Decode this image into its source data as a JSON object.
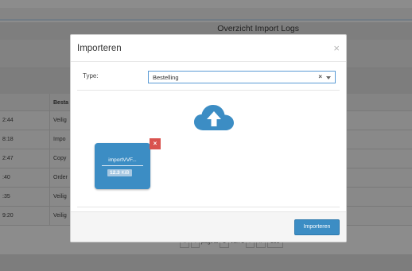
{
  "background": {
    "page_title": "Overzicht Import Logs",
    "table": {
      "header": {
        "col1": "",
        "col2": "Besta"
      },
      "rows": [
        {
          "time": "2:44",
          "text": "Veilig"
        },
        {
          "time": "8:18",
          "text": "Impo"
        },
        {
          "time": "2:47",
          "text": "Copy"
        },
        {
          "time": ":40",
          "text": "Order"
        },
        {
          "time": ":35",
          "text": "Veilig"
        },
        {
          "time": "9:20",
          "text": "Veilig"
        }
      ]
    },
    "pager": {
      "first": "«",
      "prev": "‹",
      "page_label": "pagina",
      "page_value": "1",
      "of_label": "van 1",
      "next": "›",
      "last": "»",
      "per_page": "100"
    }
  },
  "modal": {
    "title": "Importeren",
    "close_glyph": "×",
    "type_label": "Type:",
    "type_value": "Bestelling",
    "type_clear_glyph": "×",
    "file": {
      "name": "importVVF...",
      "size_value": "12.3",
      "size_unit": "KiB",
      "remove_glyph": "×"
    },
    "upload_icon": "cloud-upload-icon",
    "import_button": "Importeren"
  },
  "colors": {
    "accent": "#3c8dc4",
    "danger": "#d9534f",
    "overlay": "rgba(0,0,0,0.45)"
  }
}
